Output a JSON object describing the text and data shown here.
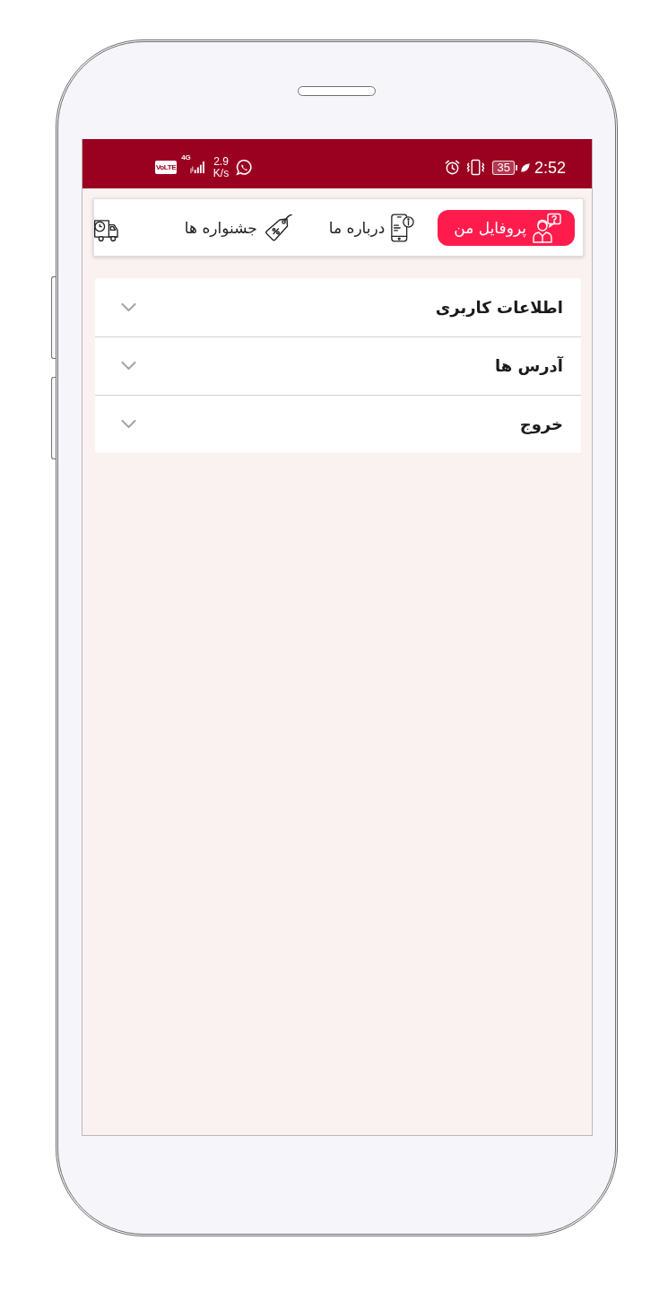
{
  "status_bar": {
    "volte": "VoLTE",
    "network": "4G",
    "speed": "2.9",
    "speed_unit": "K/s",
    "battery": "35",
    "time": "2:52"
  },
  "tabs": [
    {
      "label": "پروفایل من",
      "selected": true
    },
    {
      "label": "درباره ما",
      "selected": false
    },
    {
      "label": "جشنواره ها",
      "selected": false
    },
    {
      "selected": false
    }
  ],
  "accordion": [
    {
      "title": "اطلاعات کاربری",
      "expanded": false
    },
    {
      "title": "آدرس ها",
      "expanded": false
    },
    {
      "title": "خروج",
      "expanded": false
    }
  ]
}
